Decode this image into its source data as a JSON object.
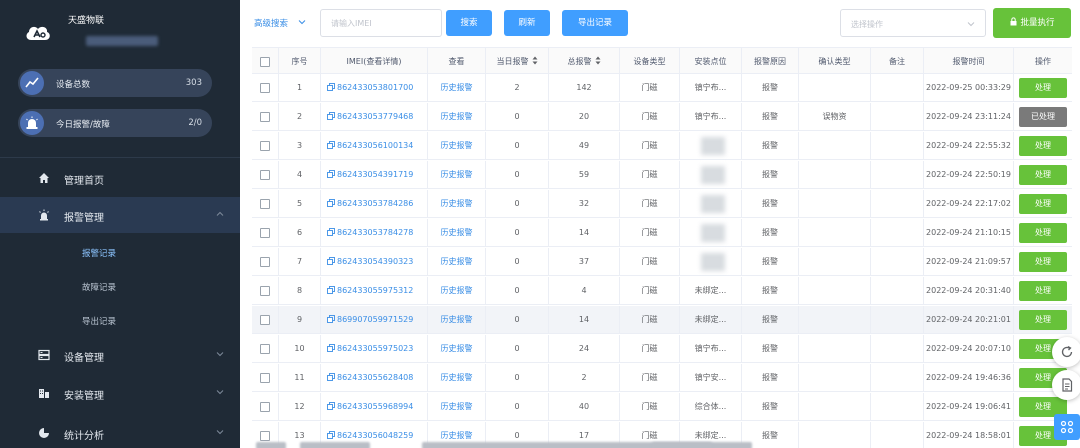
{
  "app": {
    "brand_name": "天盛物联"
  },
  "sidebar": {
    "stats": [
      {
        "label": "设备总数",
        "value": "303"
      },
      {
        "label": "今日报警/故障",
        "value": "2/0"
      }
    ],
    "nav": {
      "home": "管理首页",
      "alarm_mgmt": "报警管理",
      "sub_alarm_records": "报警记录",
      "sub_fault_records": "故障记录",
      "sub_export_records": "导出记录",
      "device_mgmt": "设备管理",
      "install_mgmt": "安装管理",
      "stats": "统计分析"
    }
  },
  "toolbar": {
    "advanced_search": "高级搜索",
    "imei_placeholder": "请输入IMEI",
    "search": "搜索",
    "refresh": "刷新",
    "export": "导出记录",
    "select_placeholder": "选择操作",
    "batch_execute": "批量执行"
  },
  "table": {
    "columns": [
      "序号",
      "IMEI(查看详情)",
      "查看",
      "当日报警",
      "总报警",
      "设备类型",
      "安装点位",
      "报警原因",
      "确认类型",
      "备注",
      "报警时间",
      "操作"
    ],
    "rows": [
      {
        "no": "1",
        "imei": "862433053801700",
        "view": "历史报警",
        "daily": "2",
        "total": "142",
        "type": "门磁",
        "location": "镇宁布...",
        "reason": "报警",
        "confirm": "",
        "note": "",
        "time": "2022-09-25 00:33:29",
        "action": "处理",
        "done": false
      },
      {
        "no": "2",
        "imei": "862433053779468",
        "view": "历史报警",
        "daily": "0",
        "total": "20",
        "type": "门磁",
        "location": "镇宁布...",
        "reason": "报警",
        "confirm": "误物资",
        "note": "",
        "time": "2022-09-24 23:11:24",
        "action": "已处理",
        "done": true
      },
      {
        "no": "3",
        "imei": "862433056100134",
        "view": "历史报警",
        "daily": "0",
        "total": "49",
        "type": "门磁",
        "location": "",
        "reason": "报警",
        "confirm": "",
        "note": "",
        "time": "2022-09-24 22:55:32",
        "action": "处理",
        "done": false
      },
      {
        "no": "4",
        "imei": "862433054391719",
        "view": "历史报警",
        "daily": "0",
        "total": "59",
        "type": "门磁",
        "location": "",
        "reason": "报警",
        "confirm": "",
        "note": "",
        "time": "2022-09-24 22:50:19",
        "action": "处理",
        "done": false
      },
      {
        "no": "5",
        "imei": "862433053784286",
        "view": "历史报警",
        "daily": "0",
        "total": "32",
        "type": "门磁",
        "location": "",
        "reason": "报警",
        "confirm": "",
        "note": "",
        "time": "2022-09-24 22:17:02",
        "action": "处理",
        "done": false
      },
      {
        "no": "6",
        "imei": "862433053784278",
        "view": "历史报警",
        "daily": "0",
        "total": "14",
        "type": "门磁",
        "location": "",
        "reason": "报警",
        "confirm": "",
        "note": "",
        "time": "2022-09-24 21:10:15",
        "action": "处理",
        "done": false
      },
      {
        "no": "7",
        "imei": "862433054390323",
        "view": "历史报警",
        "daily": "0",
        "total": "37",
        "type": "门磁",
        "location": "",
        "reason": "报警",
        "confirm": "",
        "note": "",
        "time": "2022-09-24 21:09:57",
        "action": "处理",
        "done": false
      },
      {
        "no": "8",
        "imei": "862433055975312",
        "view": "历史报警",
        "daily": "0",
        "total": "4",
        "type": "门磁",
        "location": "未绑定...",
        "reason": "报警",
        "confirm": "",
        "note": "",
        "time": "2022-09-24 20:31:40",
        "action": "处理",
        "done": false
      },
      {
        "no": "9",
        "imei": "869907059971529",
        "view": "历史报警",
        "daily": "0",
        "total": "14",
        "type": "门磁",
        "location": "未绑定...",
        "reason": "报警",
        "confirm": "",
        "note": "",
        "time": "2022-09-24 20:21:01",
        "action": "处理",
        "done": false
      },
      {
        "no": "10",
        "imei": "862433055975023",
        "view": "历史报警",
        "daily": "0",
        "total": "24",
        "type": "门磁",
        "location": "镇宁布...",
        "reason": "报警",
        "confirm": "",
        "note": "",
        "time": "2022-09-24 20:07:10",
        "action": "处理",
        "done": false
      },
      {
        "no": "11",
        "imei": "862433055628408",
        "view": "历史报警",
        "daily": "0",
        "total": "2",
        "type": "门磁",
        "location": "镇宁安...",
        "reason": "报警",
        "confirm": "",
        "note": "",
        "time": "2022-09-24 19:46:36",
        "action": "处理",
        "done": false
      },
      {
        "no": "12",
        "imei": "862433055968994",
        "view": "历史报警",
        "daily": "0",
        "total": "40",
        "type": "门磁",
        "location": "综合体...",
        "reason": "报警",
        "confirm": "",
        "note": "",
        "time": "2022-09-24 19:06:41",
        "action": "处理",
        "done": false
      },
      {
        "no": "13",
        "imei": "862433056048259",
        "view": "历史报警",
        "daily": "0",
        "total": "17",
        "type": "门磁",
        "location": "未绑定...",
        "reason": "报警",
        "confirm": "",
        "note": "",
        "time": "2022-09-24 18:58:01",
        "action": "处理",
        "done": false
      }
    ]
  },
  "colors": {
    "sidebar_bg": "#1f2a36",
    "primary": "#409eff",
    "success": "#67c23a",
    "processed": "#7a7a7a",
    "link": "#3a8ee6"
  }
}
